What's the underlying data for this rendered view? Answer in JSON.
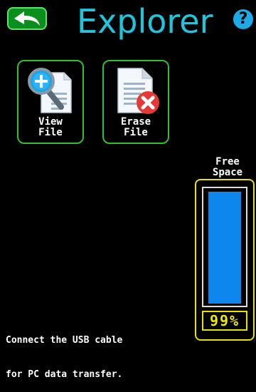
{
  "header": {
    "title": "Explorer",
    "back_icon": "back-arrow-icon",
    "help_symbol": "?"
  },
  "tiles": [
    {
      "label_line1": "View",
      "label_line2": "File",
      "icon": "magnifier-document-icon"
    },
    {
      "label_line1": "Erase",
      "label_line2": "File",
      "icon": "erase-document-icon"
    }
  ],
  "free_space": {
    "label_line1": "Free",
    "label_line2": "Space",
    "percent_text": "99%",
    "level": 0.99
  },
  "message": {
    "line1": "Connect the USB cable",
    "line2": "for PC data transfer."
  },
  "colors": {
    "title": "#1ec5dc",
    "tile_border": "#2dc233",
    "gauge_border": "#e7e200",
    "gauge_fill": "#0d86ee",
    "back_button": "#0a8f1c"
  }
}
